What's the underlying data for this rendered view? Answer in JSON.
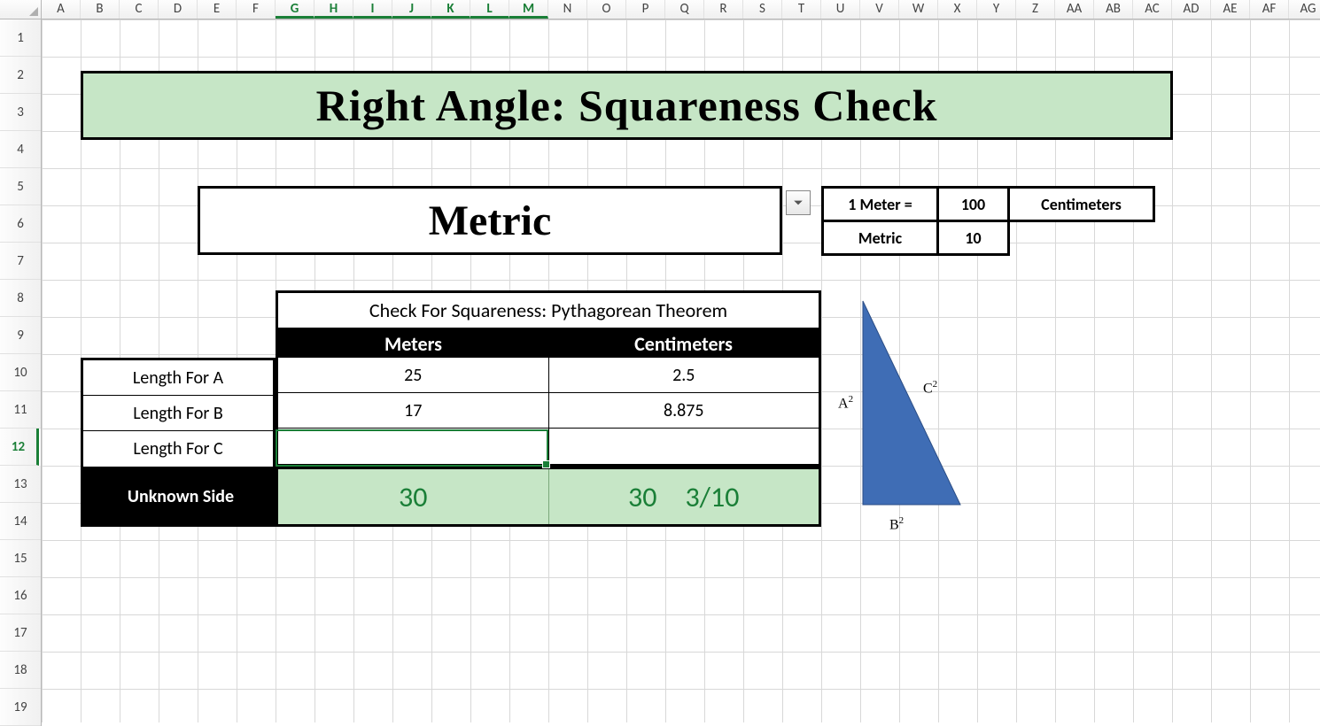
{
  "columns": [
    "A",
    "B",
    "C",
    "D",
    "E",
    "F",
    "G",
    "H",
    "I",
    "J",
    "K",
    "L",
    "M",
    "N",
    "O",
    "P",
    "Q",
    "R",
    "S",
    "T",
    "U",
    "V",
    "W",
    "X",
    "Y",
    "Z",
    "AA",
    "AB",
    "AC",
    "AD",
    "AE",
    "AF",
    "AG"
  ],
  "selected_cols": [
    "G",
    "H",
    "I",
    "J",
    "K",
    "L",
    "M"
  ],
  "rows": [
    "1",
    "2",
    "3",
    "4",
    "5",
    "6",
    "7",
    "8",
    "9",
    "10",
    "11",
    "12",
    "13",
    "14",
    "15",
    "16",
    "17",
    "18",
    "19"
  ],
  "selected_row": "12",
  "title": "Right Angle:  Squareness Check",
  "system_label": "Metric",
  "unit_box": {
    "row1": {
      "left": "1 Meter =",
      "mid": "100",
      "right": "Centimeters"
    },
    "row2": {
      "left": "Metric",
      "mid": "10"
    }
  },
  "pyth": {
    "title": "Check For Squareness: Pythagorean Theorem",
    "h1": "Meters",
    "h2": "Centimeters",
    "labels": [
      "Length For A",
      "Length For B",
      "Length For C"
    ],
    "rows": [
      {
        "c1": "25",
        "c2": "2.5"
      },
      {
        "c1": "17",
        "c2": "8.875"
      },
      {
        "c1": "",
        "c2": ""
      }
    ],
    "unknown_label": "Unknown Side",
    "unknown": {
      "whole": "30",
      "frac_int": "30",
      "frac": "3/10"
    }
  },
  "triangle": {
    "A": "A",
    "B": "B",
    "C": "C",
    "sq": "2"
  }
}
